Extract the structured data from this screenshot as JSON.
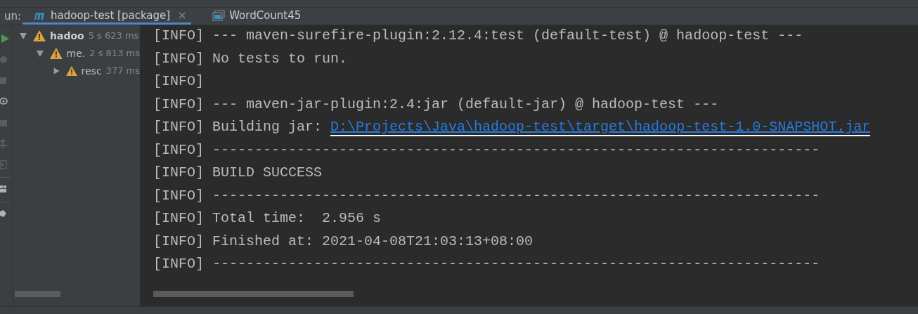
{
  "run_bar": {
    "label": "un:",
    "tabs": [
      {
        "title": "hadoop-test [package]",
        "kind": "maven",
        "selected": true
      },
      {
        "title": "WordCount45",
        "kind": "app",
        "selected": false
      }
    ]
  },
  "tree": [
    {
      "name": "hadoo",
      "time": "5 s 623 ms",
      "bold": true,
      "expanded": true,
      "children": [
        {
          "name": "me.",
          "time": "2 s 813 ms",
          "bold": false,
          "expanded": true,
          "children": [
            {
              "name": "resc",
              "time": "377 ms",
              "bold": false,
              "expanded": false
            }
          ]
        }
      ]
    }
  ],
  "console": [
    {
      "text": "[INFO] --- maven-surefire-plugin:2.12.4:test (default-test) @ hadoop-test ---"
    },
    {
      "text": "[INFO] No tests to run."
    },
    {
      "text": "[INFO]"
    },
    {
      "text": "[INFO] --- maven-jar-plugin:2.4:jar (default-jar) @ hadoop-test ---"
    },
    {
      "text": "[INFO] Building jar: ",
      "link": "D:\\Projects\\Java\\hadoop-test\\target\\hadoop-test-1.0-SNAPSHOT.jar"
    },
    {
      "text": "[INFO] ------------------------------------------------------------------------"
    },
    {
      "text": "[INFO] BUILD SUCCESS"
    },
    {
      "text": "[INFO] ------------------------------------------------------------------------"
    },
    {
      "text": "[INFO] Total time:  2.956 s"
    },
    {
      "text": "[INFO] Finished at: 2021-04-08T21:03:13+08:00"
    },
    {
      "text": "[INFO] ------------------------------------------------------------------------"
    }
  ]
}
